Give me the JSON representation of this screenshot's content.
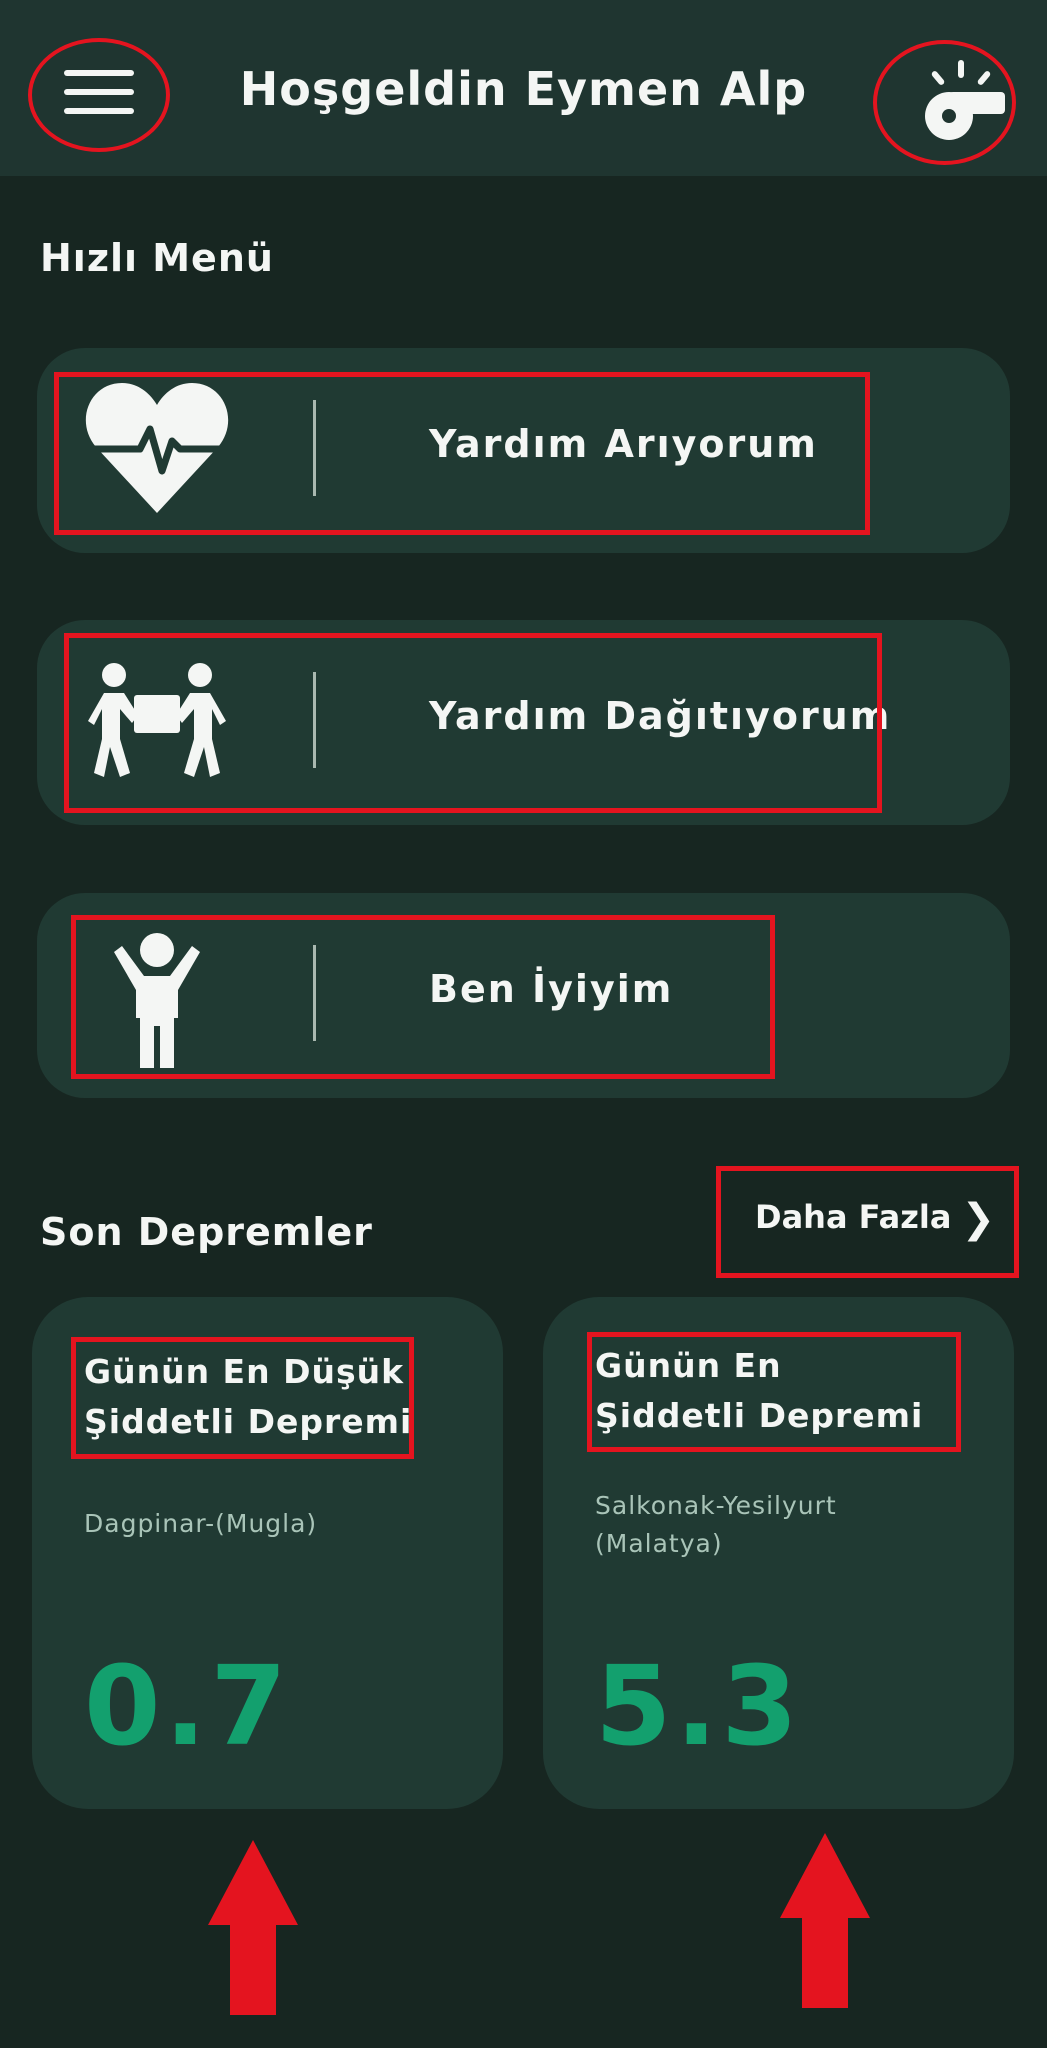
{
  "header": {
    "title": "Hoşgeldin Eymen Alp",
    "menu_icon": "hamburger-menu-icon",
    "whistle_icon": "whistle-icon"
  },
  "quick_menu": {
    "title": "Hızlı Menü",
    "items": [
      {
        "label": "Yardım Arıyorum",
        "icon": "heart-pulse-icon"
      },
      {
        "label": "Yardım Dağıtıyorum",
        "icon": "people-carrying-box-icon"
      },
      {
        "label": "Ben İyiyim",
        "icon": "person-arms-up-icon"
      }
    ]
  },
  "earthquakes": {
    "title": "Son Depremler",
    "more_label": "Daha Fazla",
    "lowest": {
      "title": "Günün En Düşük Şiddetli Depremi",
      "location": "Dagpinar-(Mugla)",
      "magnitude": "0.7"
    },
    "strongest": {
      "title": "Günün En Şiddetli Depremi",
      "location": "Salkonak-Yesilyurt (Malatya)",
      "magnitude": "5.3"
    }
  },
  "colors": {
    "background": "#172621",
    "card": "#203a33",
    "header": "#1f3530",
    "magnitude": "#13a06e",
    "annotation": "#e4141f"
  }
}
